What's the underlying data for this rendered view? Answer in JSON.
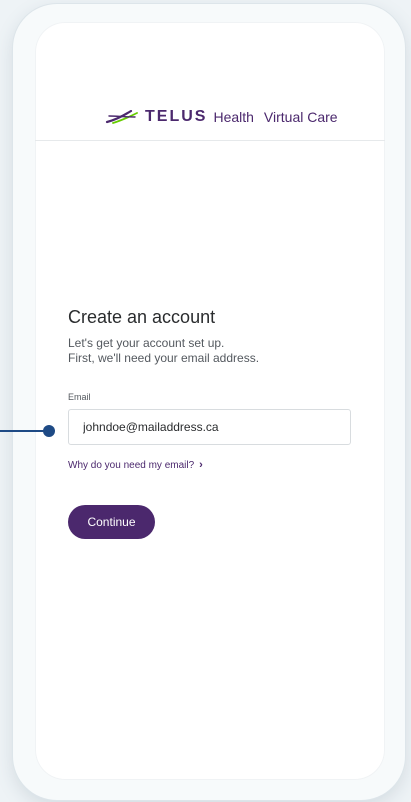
{
  "brand": {
    "name": "TELUS",
    "product": "Health",
    "service": "Virtual Care",
    "color": "#4b286d",
    "logo_icon": "telus-swoosh-icon"
  },
  "form": {
    "title": "Create an account",
    "subtitle_line1": "Let's get your account set up.",
    "subtitle_line2": "First, we'll need your email address.",
    "email_label": "Email",
    "email_value": "johndoe@mailaddress.ca",
    "why_link": "Why do you need my email?",
    "continue_label": "Continue"
  },
  "callout": {
    "color": "#1e4a85"
  }
}
